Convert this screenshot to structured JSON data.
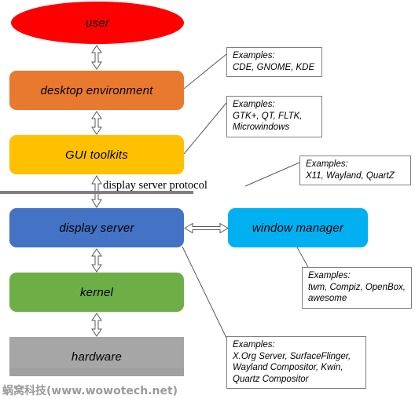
{
  "diagram": {
    "title": "display server stack diagram",
    "stack": [
      {
        "id": "user",
        "label": "user",
        "shape": "ellipse",
        "color": "#FF0000"
      },
      {
        "id": "desktop-environment",
        "label": "desktop environment",
        "shape": "rounded-rectangle",
        "color": "#E8792E"
      },
      {
        "id": "gui-toolkits",
        "label": "GUI toolkits",
        "shape": "rounded-rectangle",
        "color": "#FFC000"
      },
      {
        "id": "display-server",
        "label": "display server",
        "shape": "rounded-rectangle",
        "color": "#4472C4"
      },
      {
        "id": "kernel",
        "label": "kernel",
        "shape": "rounded-rectangle",
        "color": "#6DAE47"
      },
      {
        "id": "hardware",
        "label": "hardware",
        "shape": "rectangle",
        "color": "#A6A6A6"
      }
    ],
    "side": [
      {
        "id": "window-manager",
        "label": "window manager",
        "shape": "rounded-rectangle",
        "color": "#00B0F0"
      }
    ],
    "protocol": {
      "label": "display server protocol",
      "line_color": "#808080"
    },
    "callouts": [
      {
        "id": "callout-de",
        "heading": "Examples:",
        "body": "CDE, GNOME, KDE",
        "text": "Examples:\nCDE, GNOME, KDE",
        "points_to": "desktop environment"
      },
      {
        "id": "callout-gtk",
        "heading": "Examples:",
        "body": "GTK+, QT, FLTK,\nMicrowindows",
        "text": "Examples:\nGTK+, QT, FLTK,\nMicrowindows",
        "points_to": "GUI toolkits"
      },
      {
        "id": "callout-ds-protocol",
        "heading": "Examples:",
        "body": "X11, Wayland, QuartZ",
        "text": "Examples:\nX11, Wayland, QuartZ",
        "points_to": "display server protocol"
      },
      {
        "id": "callout-wm",
        "heading": "Examples:",
        "body": "twm, Compiz, OpenBox,\nawesome",
        "text": "Examples:\ntwm, Compiz, OpenBox,\nawesome",
        "points_to": "window manager"
      },
      {
        "id": "callout-ds",
        "heading": "Examples:",
        "body": "X.Org Server, SurfaceFlinger,\nWayland Compositor, Kwin,\nQuartz Compositor",
        "text": "Examples:\nX.Org Server, SurfaceFlinger,\nWayland Compositor, Kwin,\nQuartz Compositor",
        "points_to": "display server"
      }
    ],
    "connectors": [
      {
        "id": "arrow-user-de",
        "type": "vertical-double-arrow",
        "from": "user",
        "to": "desktop environment"
      },
      {
        "id": "arrow-de-gui",
        "type": "vertical-double-arrow",
        "from": "desktop environment",
        "to": "GUI toolkits"
      },
      {
        "id": "arrow-gui-ds",
        "type": "vertical-double-arrow",
        "from": "GUI toolkits",
        "to": "display server"
      },
      {
        "id": "arrow-ds-kernel",
        "type": "vertical-double-arrow",
        "from": "display server",
        "to": "kernel"
      },
      {
        "id": "arrow-kernel-hw",
        "type": "vertical-double-arrow",
        "from": "kernel",
        "to": "hardware"
      },
      {
        "id": "arrow-ds-wm",
        "type": "horizontal-double-arrow",
        "from": "display server",
        "to": "window manager"
      }
    ],
    "watermark": "蜗窝科技(www.wowotech.net)"
  }
}
